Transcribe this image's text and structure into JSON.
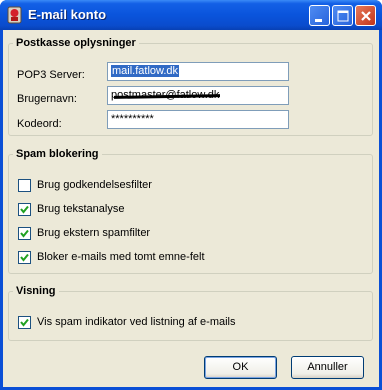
{
  "window": {
    "title": "E-mail konto",
    "icon": "red-app-icon"
  },
  "titlebar_buttons": [
    "minimize",
    "maximize",
    "close"
  ],
  "groups": {
    "mailbox": {
      "title": "Postkasse oplysninger",
      "fields": [
        {
          "label": "POP3 Server:",
          "value": "mail.fatlow.dk",
          "selected": true
        },
        {
          "label": "Brugernavn:",
          "value": "postmaster@fatlow.dk",
          "redacted": true
        },
        {
          "label": "Kodeord:",
          "value": "**********"
        }
      ]
    },
    "spam": {
      "title": "Spam blokering",
      "options": [
        {
          "label": "Brug godkendelsesfilter",
          "checked": false
        },
        {
          "label": "Brug tekstanalyse",
          "checked": true
        },
        {
          "label": "Brug ekstern spamfilter",
          "checked": true
        },
        {
          "label": "Bloker e-mails med tomt emne-felt",
          "checked": true
        }
      ]
    },
    "display": {
      "title": "Visning",
      "options": [
        {
          "label": "Vis spam indikator ved listning af e-mails",
          "checked": true
        }
      ]
    }
  },
  "buttons": {
    "ok": "OK",
    "cancel": "Annuller"
  }
}
